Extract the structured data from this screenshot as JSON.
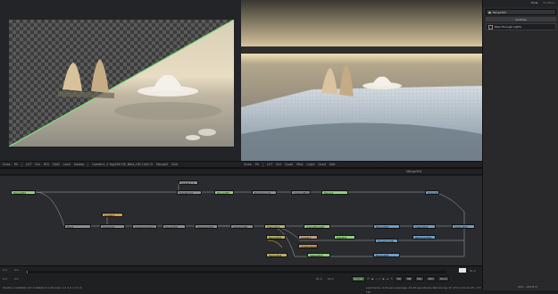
{
  "left_viewer": {
    "toolbar": [
      "Subv",
      "Fit",
      "LUT",
      "Ext",
      "ROI",
      "DoD",
      "Lock",
      "Sweep",
      "Loader1_1 fog360 DE_Bots_HD 1440 lt",
      "MergeS",
      "Edit"
    ]
  },
  "right_viewer": {
    "toolbar": [
      "Subv",
      "Fit",
      "LUT",
      "Ext",
      "Quad",
      "Mist",
      "Light",
      "Grad",
      "Edit"
    ]
  },
  "right_panel": {
    "tabs": [
      "Tools",
      "Modifiers"
    ],
    "node_name": "Merge304",
    "section": "Controls",
    "option": "Pass Through Lights"
  },
  "flow": {
    "tabs": [
      "Flow",
      "Console",
      "Timeline",
      "Spline"
    ],
    "label": "Merge304",
    "nodes": [
      {
        "label": "Merge304",
        "color": "n-green"
      },
      {
        "label": "Loader1_1",
        "color": "n-gray"
      },
      {
        "label": "Transform1",
        "color": "n-gray"
      },
      {
        "label": "MergeDE1",
        "color": "n-green"
      },
      {
        "label": "Background1",
        "color": "n-gray"
      },
      {
        "label": "ChannelBooleans1",
        "color": "n-gray"
      },
      {
        "label": "Merge1",
        "color": "n-green"
      },
      {
        "label": "Loader2",
        "color": "n-orange"
      },
      {
        "label": "Blur1",
        "color": "n-gray"
      },
      {
        "label": "Displace1",
        "color": "n-gray"
      },
      {
        "label": "ColorCorrector1",
        "color": "n-gray"
      },
      {
        "label": "Merge3D1",
        "color": "n-blue"
      },
      {
        "label": "Renderer3D1",
        "color": "n-blue"
      },
      {
        "label": "Camera3D1",
        "color": "n-olive"
      },
      {
        "label": "Shape3D1",
        "color": "n-blue"
      },
      {
        "label": "ImagePlane3D",
        "color": "n-blue"
      },
      {
        "label": "Merge3D2",
        "color": "n-blue"
      },
      {
        "label": "Shape3D2",
        "color": "n-blue"
      },
      {
        "label": "SpotLight1",
        "color": "n-olive"
      },
      {
        "label": "Merge3D3",
        "color": "n-blue"
      },
      {
        "label": "Loader3",
        "color": "n-tan"
      },
      {
        "label": "Text3D1",
        "color": "n-blue"
      },
      {
        "label": "Transform3D",
        "color": "n-blue"
      },
      {
        "label": "Renderer3D2",
        "color": "n-blue"
      },
      {
        "label": "AmbientLight1",
        "color": "n-olive"
      },
      {
        "label": "Merge3D4",
        "color": "n-blue"
      },
      {
        "label": "Shape3D3",
        "color": "n-blue"
      },
      {
        "label": "Merge3D5",
        "color": "n-blue"
      },
      {
        "label": "Output1",
        "color": "n-blue"
      }
    ]
  },
  "timeline": {
    "start": "0.0",
    "current": "0.0",
    "end": "91.0",
    "end2": "91.0",
    "render_label": "Render",
    "hq_label": "HQ",
    "mb_label": "MB",
    "prx_label": "PRx",
    "aprx_label": "APrx",
    "some_label": "Some",
    "frame_box": "91.0"
  },
  "status_bar": {
    "left": "Position  1.000000   X/Y   0.20000   Z   0.00   Color  1.0   1.0   1.0   1.0",
    "right": "Last frame: 0.04 secs  Average: 24.20 secs/frame  Remaining: 2h 37m 0.0s  41.4% | 53 FPS",
    "mem": "69% - 987/8 M"
  },
  "colors": {
    "accent_green": "#8fcf7c",
    "viewer_bg": "#232427",
    "flow_bg": "#2a2b2e"
  }
}
